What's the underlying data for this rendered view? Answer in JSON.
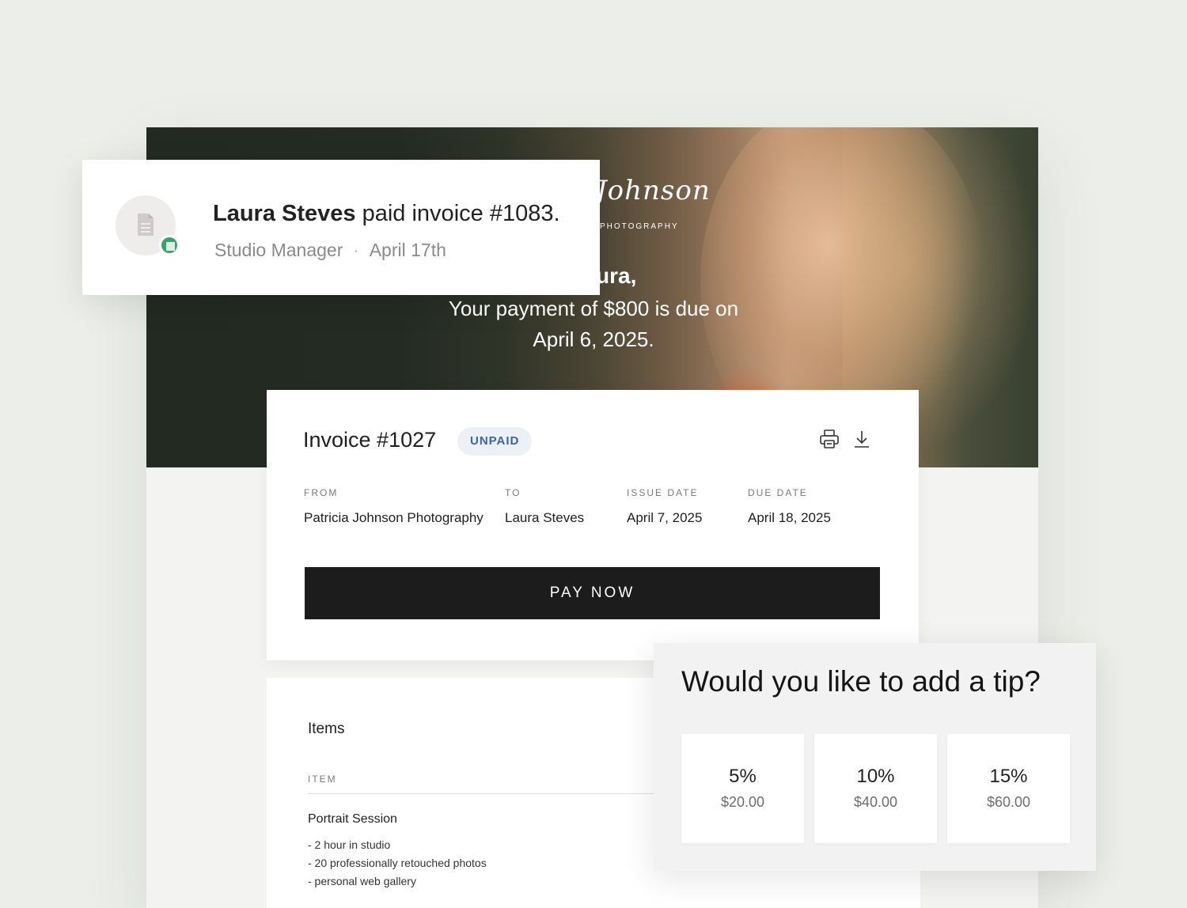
{
  "hero": {
    "brand_script": "Johnson",
    "brand_sub": "PHOTOGRAPHY",
    "greeting": "ura,",
    "message": "Your payment of $800 is due on April 6, 2025."
  },
  "invoice": {
    "title": "Invoice #1027",
    "status": "UNPAID",
    "icons": [
      "printer-icon",
      "download-icon"
    ],
    "fields": [
      {
        "label": "FROM",
        "value": "Patricia Johnson Photography"
      },
      {
        "label": "TO",
        "value": "Laura Steves"
      },
      {
        "label": "ISSUE DATE",
        "value": "April 7, 2025"
      },
      {
        "label": "DUE DATE",
        "value": "April 18, 2025"
      }
    ],
    "pay_label": "PAY NOW"
  },
  "items": {
    "title": "Items",
    "column_item": "ITEM",
    "rows": [
      {
        "name": "Portrait Session",
        "details": [
          "- 2 hour in studio",
          "- 20 professionally retouched photos",
          "- personal web gallery"
        ]
      }
    ]
  },
  "notification": {
    "name": "Laura Steves",
    "action": " paid invoice #1083.",
    "source": "Studio Manager",
    "separator": "·",
    "date": "April 17th",
    "icon": "document-icon"
  },
  "tip": {
    "title": "Would you like to add a tip?",
    "options": [
      {
        "percent": "5%",
        "amount": "$20.00"
      },
      {
        "percent": "10%",
        "amount": "$40.00"
      },
      {
        "percent": "15%",
        "amount": "$60.00"
      }
    ]
  },
  "colors": {
    "background": "#ebeee9",
    "button": "#1c1c1c",
    "badge_text": "#3e62b0",
    "badge_bg": "#edf0f5",
    "app_accent": "#3d9f73"
  }
}
